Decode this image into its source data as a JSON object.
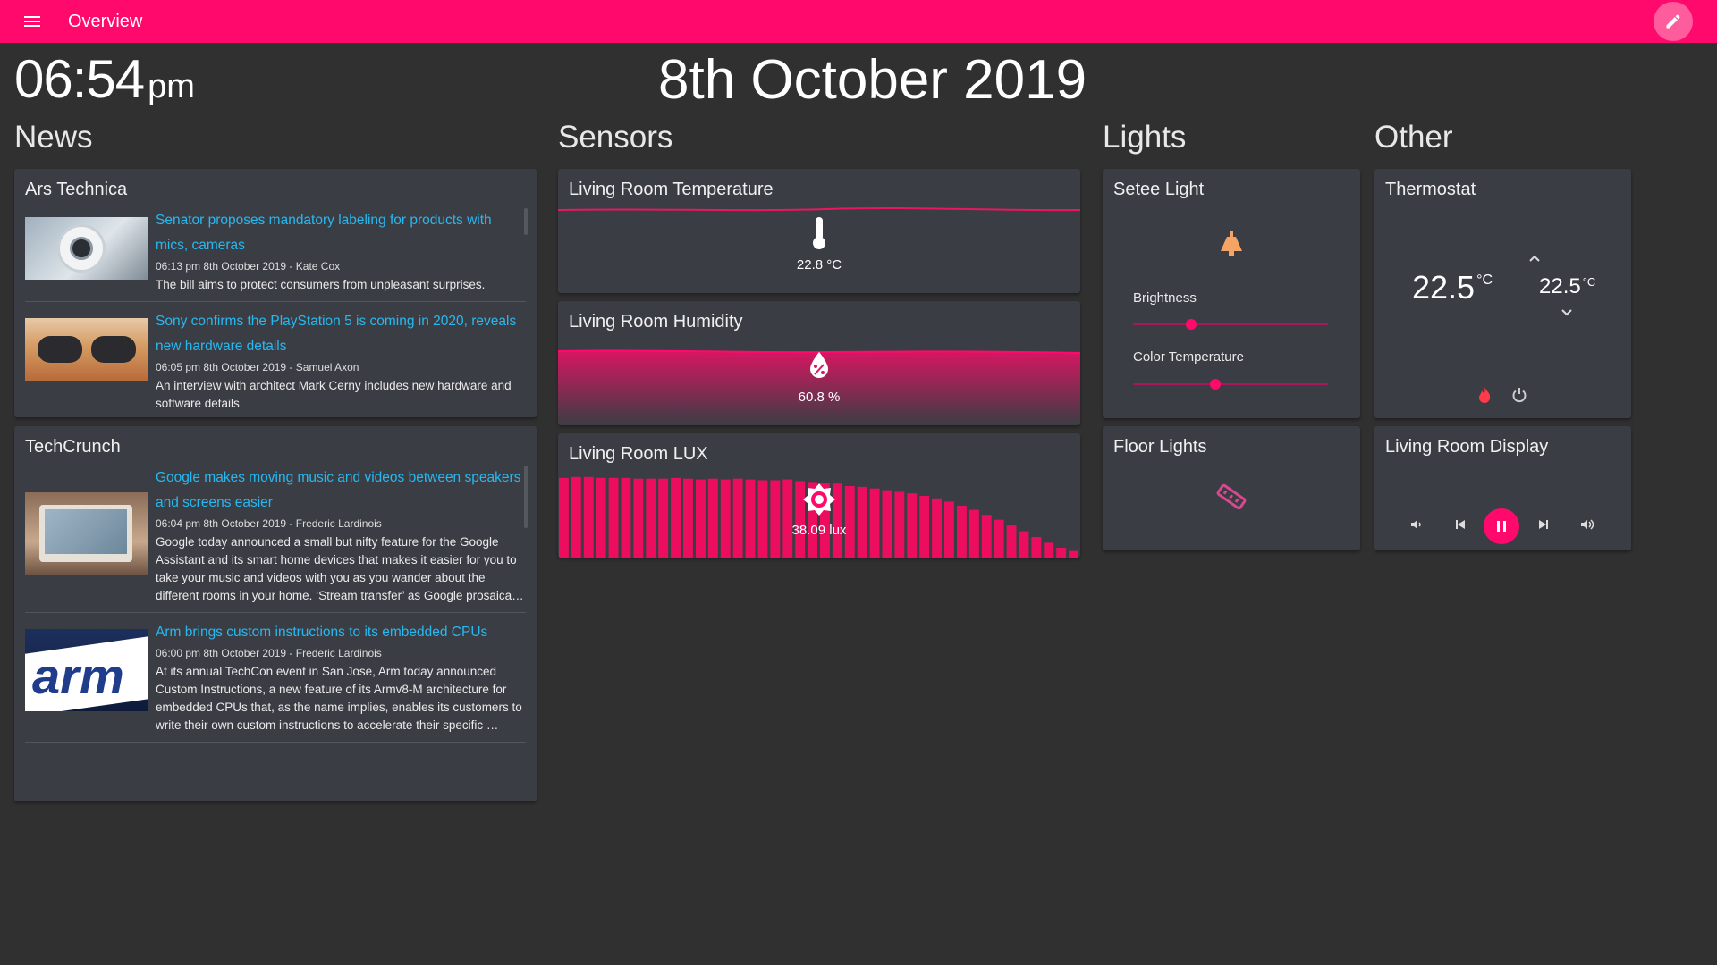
{
  "header": {
    "title": "Overview",
    "menu_icon": "menu-icon",
    "edit_icon": "pencil-icon",
    "accent": "#ff0a6c"
  },
  "clock": {
    "time": "06:54",
    "ampm": "pm",
    "date": "8th October 2019"
  },
  "columns": {
    "news": "News",
    "sensors": "Sensors",
    "lights": "Lights",
    "other": "Other"
  },
  "news": {
    "ars": {
      "title": "Ars Technica",
      "items": [
        {
          "headline": "Senator proposes mandatory labeling for products with mics, cameras",
          "meta": "06:13 pm 8th October 2019 - Kate Cox",
          "desc": "The bill aims to protect consumers from unpleasant surprises."
        },
        {
          "headline": "Sony confirms the PlayStation 5 is coming in 2020, reveals new hardware details",
          "meta": "06:05 pm 8th October 2019 - Samuel Axon",
          "desc": "An interview with architect Mark Cerny includes new hardware and software details"
        }
      ]
    },
    "techcrunch": {
      "title": "TechCrunch",
      "items": [
        {
          "headline": "Google makes moving music and videos between speakers and screens easier",
          "meta": "06:04 pm 8th October 2019 - Frederic Lardinois",
          "desc": "Google today announced a small but nifty feature for the Google Assistant and its smart home devices that makes it easier for you to take your music and videos with you as you wander about the different rooms in your home. ‘Stream transfer’ as Google prosaica…"
        },
        {
          "headline": "Arm brings custom instructions to its embedded CPUs",
          "meta": "06:00 pm 8th October 2019 - Frederic Lardinois",
          "desc": "At its annual TechCon event in San Jose, Arm today announced Custom Instructions, a new feature of its Armv8-M architecture for embedded CPUs that, as the name implies, enables its customers to write their own custom instructions to accelerate their specific …",
          "thumb_text": "arm"
        }
      ]
    }
  },
  "sensors": {
    "temperature": {
      "title": "Living Room Temperature",
      "value": "22.8 °C"
    },
    "humidity": {
      "title": "Living Room Humidity",
      "value": "60.8 %"
    },
    "lux": {
      "title": "Living Room LUX",
      "value": "38.09 lux",
      "history": [
        0.97,
        0.98,
        0.98,
        0.97,
        0.97,
        0.97,
        0.96,
        0.96,
        0.96,
        0.97,
        0.96,
        0.95,
        0.96,
        0.95,
        0.96,
        0.95,
        0.94,
        0.94,
        0.95,
        0.93,
        0.92,
        0.91,
        0.9,
        0.87,
        0.86,
        0.84,
        0.82,
        0.8,
        0.78,
        0.75,
        0.72,
        0.68,
        0.63,
        0.58,
        0.52,
        0.46,
        0.39,
        0.32,
        0.25,
        0.18,
        0.12,
        0.08
      ]
    }
  },
  "lights": {
    "setee": {
      "title": "Setee Light",
      "brightness_label": "Brightness",
      "brightness": 0.3,
      "color_temp_label": "Color Temperature",
      "color_temp": 0.42,
      "icon_color": "#f6a465"
    },
    "floor": {
      "title": "Floor Lights",
      "icon_color": "#d9478f"
    }
  },
  "other": {
    "thermostat": {
      "title": "Thermostat",
      "current": "22.5",
      "target": "22.5",
      "unit": "°C",
      "flame_color": "#ff3a4a"
    },
    "display": {
      "title": "Living Room Display"
    }
  }
}
